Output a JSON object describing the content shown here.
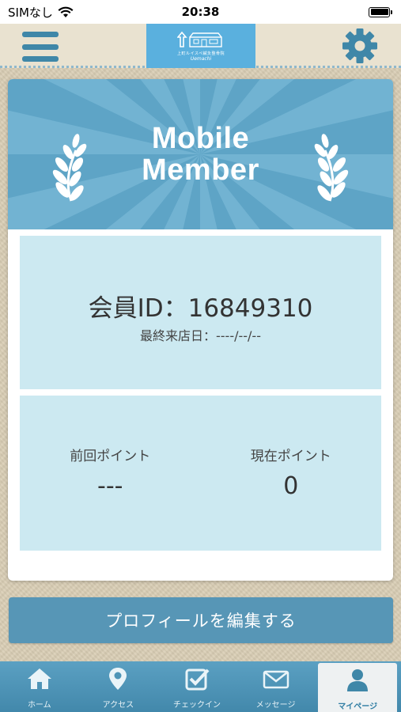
{
  "status_bar": {
    "carrier": "SIMなし",
    "time": "20:38"
  },
  "header": {
    "logo_sub": "上町ルイスペ鍼灸整骨院",
    "logo_en": "Uemachi",
    "menu_icon": "hamburger-menu-icon",
    "settings_icon": "gear-icon"
  },
  "card": {
    "banner_title_line1": "Mobile",
    "banner_title_line2": "Member",
    "member_id": "会員ID：16849310",
    "last_visit": "最終来店日：----/--/--",
    "points": [
      {
        "label": "前回ポイント",
        "value": "---"
      },
      {
        "label": "現在ポイント",
        "value": "0"
      }
    ]
  },
  "edit_profile_label": "プロフィールを編集する",
  "tabs": [
    {
      "label": "ホーム",
      "icon": "home-icon",
      "active": false
    },
    {
      "label": "アクセス",
      "icon": "map-pin-icon",
      "active": false
    },
    {
      "label": "チェックイン",
      "icon": "checkbox-icon",
      "active": false
    },
    {
      "label": "メッセージ",
      "icon": "envelope-icon",
      "active": false
    },
    {
      "label": "マイページ",
      "icon": "person-icon",
      "active": true
    }
  ],
  "colors": {
    "accent": "#4a90b4",
    "panel": "#cce9f1",
    "background": "#d9cdb4",
    "logo": "#5ab0de"
  }
}
